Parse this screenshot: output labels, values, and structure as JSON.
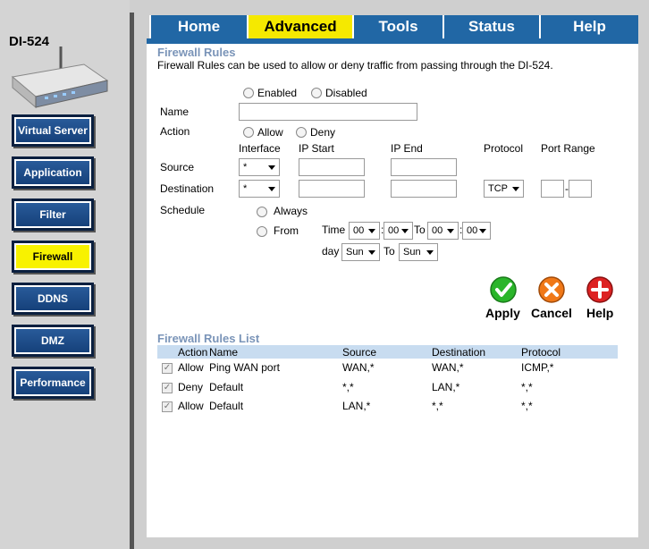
{
  "brand": "DI-524",
  "nav": [
    {
      "label": "Virtual Server"
    },
    {
      "label": "Application"
    },
    {
      "label": "Filter"
    },
    {
      "label": "Firewall",
      "active": true
    },
    {
      "label": "DDNS"
    },
    {
      "label": "DMZ"
    },
    {
      "label": "Performance"
    }
  ],
  "tabs": [
    "Home",
    "Advanced",
    "Tools",
    "Status",
    "Help"
  ],
  "section": {
    "title": "Firewall Rules",
    "description": "Firewall Rules can be used to allow or deny traffic from passing through the DI-524."
  },
  "form": {
    "enabled_label": "Enabled",
    "disabled_label": "Disabled",
    "name_label": "Name",
    "name_value": "",
    "action_label": "Action",
    "allow_label": "Allow",
    "deny_label": "Deny",
    "col_interface": "Interface",
    "col_ip_start": "IP Start",
    "col_ip_end": "IP End",
    "col_protocol": "Protocol",
    "col_port_range": "Port Range",
    "source_label": "Source",
    "source_interface": "*",
    "destination_label": "Destination",
    "destination_interface": "*",
    "destination_protocol": "TCP",
    "schedule_label": "Schedule",
    "always_label": "Always",
    "from_label": "From",
    "time_label": "Time",
    "to_label": "To",
    "day_label": "day",
    "time_from_h": "00",
    "time_from_m": "00",
    "time_to_h": "00",
    "time_to_m": "00",
    "day_from": "Sun",
    "day_to": "Sun",
    "dash": "-"
  },
  "actions": {
    "apply": "Apply",
    "cancel": "Cancel",
    "help": "Help"
  },
  "list": {
    "title": "Firewall Rules List",
    "headers": [
      "Action",
      "Name",
      "Source",
      "Destination",
      "Protocol"
    ],
    "rows": [
      {
        "check": "✓",
        "action": "Allow",
        "name": "Ping WAN port",
        "source": "WAN,*",
        "destination": "WAN,*",
        "protocol": "ICMP,*"
      },
      {
        "check": "✓",
        "action": "Deny",
        "name": "Default",
        "source": "*,*",
        "destination": "LAN,*",
        "protocol": "*,*"
      },
      {
        "check": "✓",
        "action": "Allow",
        "name": "Default",
        "source": "LAN,*",
        "destination": "*,*",
        "protocol": "*,*"
      }
    ]
  },
  "colors": {
    "tab_blue": "#2167a5",
    "tab_active": "#f5e900",
    "nav_active": "#f8f200",
    "apply_green": "#2ab52a",
    "cancel_orange": "#f07818",
    "help_red": "#dd2222"
  }
}
